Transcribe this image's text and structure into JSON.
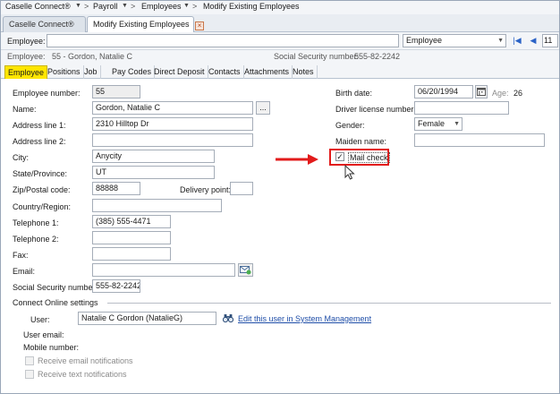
{
  "breadcrumb": [
    "Caselle Connect®",
    "Payroll",
    "Employees",
    "Modify Existing Employees"
  ],
  "window_tabs": [
    {
      "label": "Caselle Connect®",
      "active": false
    },
    {
      "label": "Modify Existing Employees",
      "active": true
    }
  ],
  "selector": {
    "label": "Employee:",
    "value": "",
    "mode_value": "Employee",
    "record_number": "11"
  },
  "summary": {
    "employee_label": "Employee:",
    "employee_value": "55 - Gordon, Natalie C",
    "ssn_label": "Social Security number:",
    "ssn_value": "555-82-2242"
  },
  "section_tabs": [
    "Employee",
    "Positions",
    "Job",
    "Pay Codes",
    "Direct Deposit",
    "Contacts",
    "Attachments",
    "Notes"
  ],
  "form": {
    "employee_number": {
      "label": "Employee number:",
      "value": "55"
    },
    "name": {
      "label": "Name:",
      "value": "Gordon, Natalie C",
      "button": "..."
    },
    "address1": {
      "label": "Address line 1:",
      "value": "2310 Hilltop Dr"
    },
    "address2": {
      "label": "Address line 2:",
      "value": ""
    },
    "city": {
      "label": "City:",
      "value": "Anycity"
    },
    "state": {
      "label": "State/Province:",
      "value": "UT"
    },
    "zip": {
      "label": "Zip/Postal code:",
      "value": "88888"
    },
    "delivery_point": {
      "label": "Delivery point:",
      "value": ""
    },
    "country": {
      "label": "Country/Region:",
      "value": ""
    },
    "telephone1": {
      "label": "Telephone 1:",
      "value": "(385) 555-4471"
    },
    "telephone2": {
      "label": "Telephone 2:",
      "value": ""
    },
    "fax": {
      "label": "Fax:",
      "value": ""
    },
    "email": {
      "label": "Email:",
      "value": ""
    },
    "ssn": {
      "label": "Social Security number:",
      "value": "555-82-2242"
    },
    "birth_date": {
      "label": "Birth date:",
      "value": "06/20/1994"
    },
    "age": {
      "label": "Age:",
      "value": "26"
    },
    "driver_license": {
      "label": "Driver license number:",
      "value": ""
    },
    "gender": {
      "label": "Gender:",
      "value": "Female"
    },
    "maiden_name": {
      "label": "Maiden name:",
      "value": ""
    },
    "mail_check": {
      "label": "Mail check",
      "checked": true
    }
  },
  "connect_online": {
    "heading": "Connect Online settings",
    "user_label": "User:",
    "user_value": "Natalie C Gordon (NatalieG)",
    "edit_link": "Edit this user in System Management",
    "user_email_label": "User email:",
    "mobile_label": "Mobile number:",
    "receive_email": "Receive email notifications",
    "receive_text": "Receive text notifications"
  },
  "colors": {
    "active_tab": "#ffe600",
    "annotation": "#e21b1b",
    "link": "#1f4ea8"
  }
}
